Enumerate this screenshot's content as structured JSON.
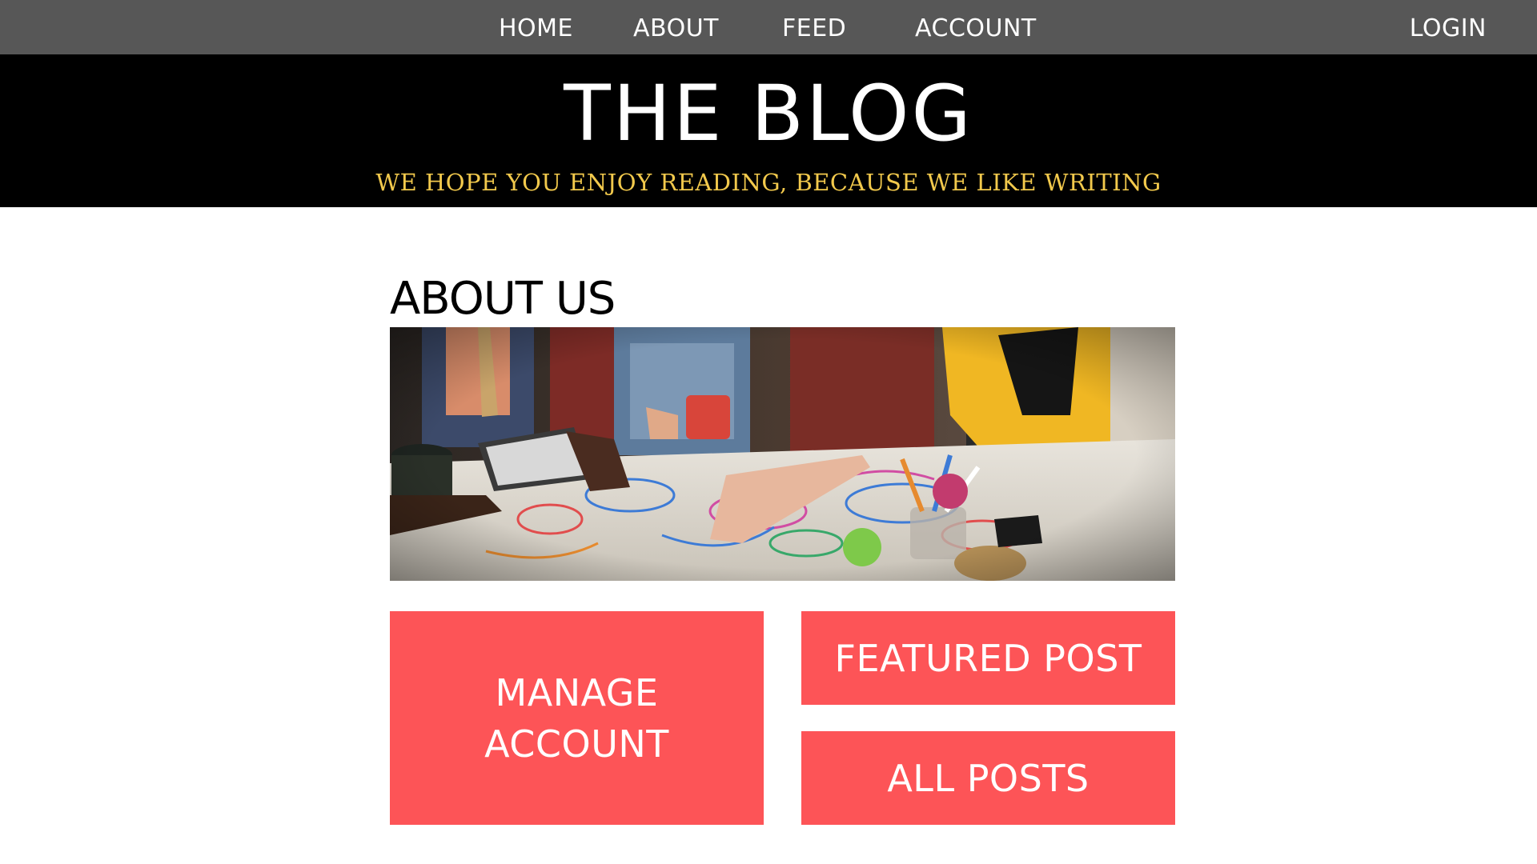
{
  "nav": {
    "items": [
      {
        "label": "HOME"
      },
      {
        "label": "ABOUT"
      },
      {
        "label": "FEED"
      },
      {
        "label": "ACCOUNT"
      }
    ],
    "login_label": "LOGIN"
  },
  "banner": {
    "title": "THE BLOG",
    "tagline": "WE HOPE YOU ENJOY READING, BECAUSE WE LIKE WRITING"
  },
  "about": {
    "heading": "ABOUT US",
    "photo_subject": "people-collaborating-over-mind-map"
  },
  "tiles": {
    "manage_account": "MANAGE ACCOUNT",
    "featured_post": "FEATURED POST",
    "all_posts": "ALL POSTS"
  },
  "colors": {
    "nav_bg": "#575757",
    "banner_bg": "#000000",
    "tagline": "#f2c94c",
    "tile_bg": "#fd5457",
    "page_bg": "#ffffff"
  }
}
